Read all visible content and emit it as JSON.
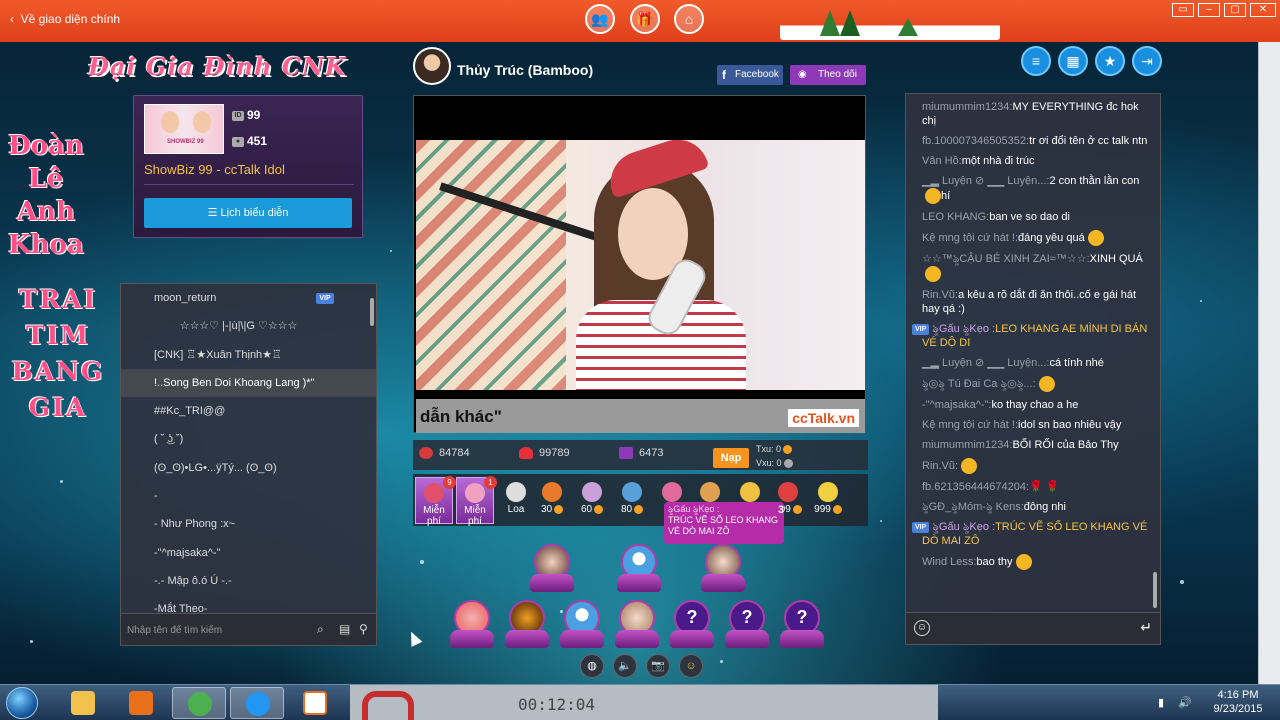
{
  "app": {
    "back_label": "Về giao diện chính",
    "window_controls": [
      "▭",
      "–",
      "▢",
      "✕"
    ]
  },
  "logo": {
    "text": "Đại Gia Đình CNK"
  },
  "decor": {
    "name_lines": [
      "Đoàn",
      "Lê",
      "Anh",
      "Khoa"
    ],
    "tagline_lines": [
      "TRAI",
      "TIM",
      "BANG",
      "GIA"
    ]
  },
  "profile": {
    "room_id": "99",
    "members": "451",
    "name": "ShowBiz 99 - ccTalk Idol",
    "schedule_label": "Lịch biểu diễn",
    "thumb_caption": "SHOWBIZ 99"
  },
  "user_list": {
    "items": [
      {
        "name": "moon_return",
        "vip": "VIP",
        "align": "left",
        "selected": false
      },
      {
        "name": "☆☆☆♡ |-|ù|\\|G ♡☆☆☆",
        "align": "center",
        "selected": false
      },
      {
        "name": "[CNK] ♖★Xuân Thịnh★♖",
        "align": "left",
        "selected": false
      },
      {
        "name": "!..Song Ben Doi Khoang Lang )*\"",
        "align": "left",
        "selected": true
      },
      {
        "name": "##Kc_TRI@@",
        "align": "left",
        "selected": false
      },
      {
        "name": "( ˘ ͜ʖ ˘)",
        "align": "left",
        "selected": false
      },
      {
        "name": "(ʘ_ʘ)•LG•...ÿTý... (ʘ_ʘ)",
        "align": "left",
        "selected": false
      },
      {
        "name": "-",
        "align": "left",
        "selected": false
      },
      {
        "name": "- Như Phong :x~",
        "align": "left",
        "selected": false
      },
      {
        "name": "-\"^majsaka^-\"",
        "align": "left",
        "selected": false
      },
      {
        "name": "-.- Mập ô.ó Ú -.-",
        "align": "left",
        "selected": false
      },
      {
        "name": "-Mắt Theo-",
        "align": "left",
        "selected": false
      }
    ],
    "search_placeholder": "Nhập tên để tìm kiếm"
  },
  "host": {
    "name": "Thủy Trúc (Bamboo)",
    "facebook_label": "Facebook",
    "follow_label": "Theo dõi"
  },
  "video": {
    "caption": "dẫn khác\"",
    "brand": "ccTalk.vn"
  },
  "stats": {
    "roses": "84784",
    "hearts": "99789",
    "followers": "6473",
    "nap_label": "Nạp",
    "txu_label": "Txu:",
    "txu_value": "0",
    "vxu_label": "Vxu:",
    "vxu_value": "0"
  },
  "gifts": [
    {
      "label": "Miễn phí",
      "badge": "9",
      "free": true,
      "color": "#e0506a"
    },
    {
      "label": "Miễn phí",
      "badge": "1",
      "free": true,
      "color": "#f0a0c0"
    },
    {
      "label": "Loa",
      "free": false,
      "color": "#ddd"
    },
    {
      "label": "30",
      "price": true,
      "color": "#e87a2a"
    },
    {
      "label": "60",
      "price": true,
      "color": "#c9a0d8"
    },
    {
      "label": "80",
      "price": true,
      "color": "#5aa0d8"
    },
    {
      "label": "",
      "price": false,
      "color": "#e06a9a"
    },
    {
      "label": "",
      "price": false,
      "color": "#e0a050"
    },
    {
      "label": "",
      "price": false,
      "color": "#f0c040"
    },
    {
      "label": "999",
      "price": true,
      "color": "#e04040"
    },
    {
      "label": "999",
      "price": true,
      "color": "#f0d040"
    }
  ],
  "gift_tooltip": {
    "user": "ৡGấu ৡKẹo :",
    "text": "TRÚC VẼ SỐ LEO KHANG VÉ DÒ MAI ZÔ",
    "count": "3"
  },
  "seats": {
    "question_mark": "?"
  },
  "chat": {
    "messages": [
      {
        "user": "miumummim1234:",
        "text": "MY EVERYTHING đc hok chị"
      },
      {
        "user": "fb.100007346505352:",
        "text": "tr ơi đổi tên ở cc talk ntn"
      },
      {
        "user": "Vân Hồ:",
        "text": "một nhà đi trúc"
      },
      {
        "user": "▁▂ Luyện ⊘ ▁▁ Luyện...:",
        "text": "2 con thằn lằn con",
        "emoji": true,
        "after": "hí"
      },
      {
        "user": "LEO KHANG:",
        "text": "ban ve so dao di"
      },
      {
        "user": "Kệ mng tôi cứ hát !:",
        "text": "đáng yêu quá",
        "emoji": true
      },
      {
        "user": "☆☆™ৡCẬU BÉ XINH ZAI≈™☆☆:",
        "text": "XINH QUÁ",
        "emoji": true
      },
      {
        "user": "Rin.Vũ:",
        "text": "a kêu a rõ dắt đi ăn thôi..cố e gái hát hay qá :)"
      },
      {
        "user": "ৡGấu ৡKẹo :",
        "text": "LEO KHANG AE MÌNH DI BÁN VÉ DỘ DI",
        "vip": "VIP",
        "highlight": true
      },
      {
        "user": "▁▂ Luyện ⊘ ▁▁ Luyện...:",
        "text": "cá tính nhé"
      },
      {
        "user": "ৡ◎ৡ Tú Đai Ca ৡ◎ৡ...:",
        "text": "",
        "emoji": true
      },
      {
        "user": "-\"^majsaka^-\":",
        "text": "ko thay chao a he"
      },
      {
        "user": "Kệ mng tôi cứ hát !:",
        "text": "idol sn bao nhiêu vậy"
      },
      {
        "user": "miumummim1234:",
        "text": "BỐI RỐI của Bảo Thy"
      },
      {
        "user": "Rin.Vũ:",
        "text": "",
        "emoji": true
      },
      {
        "user": "fb.621356444674204:",
        "text": "🌹 🌹"
      },
      {
        "user": "ৡGĐ_ৡMóm-ৡ Kens:",
        "text": "đông nhi"
      },
      {
        "user": "ৡGấu ৡKẹo :",
        "text": "TRÚC VẼ SỐ LEO KHANG VÉ DÒ MAI ZÔ",
        "vip": "VIP",
        "highlight": true
      },
      {
        "user": "Wind Less:",
        "text": "bao thy",
        "emoji": true
      }
    ],
    "input_placeholder": ""
  },
  "taskbar": {
    "time": "4:16 PM",
    "date": "9/23/2015",
    "preview_text": "00:12:04"
  },
  "colors": {
    "top_bar": "#e84a21",
    "accent_blue": "#1a9ad8",
    "gold": "#f4c23e",
    "purple": "#8e3ab8"
  }
}
